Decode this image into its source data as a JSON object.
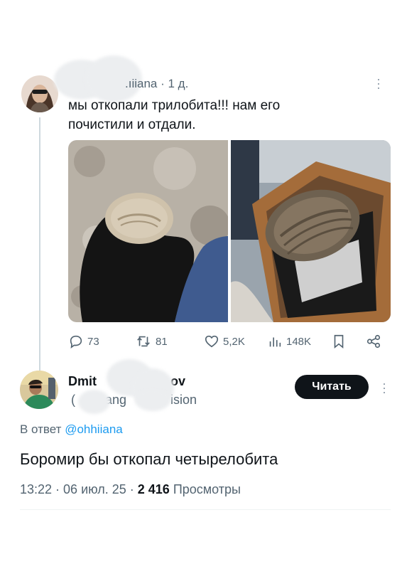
{
  "tweet": {
    "handle_fragment": ".ıiiana",
    "time": "· 1 д.",
    "text_line1": "мы откопали трилобита!!! нам его",
    "text_line2": "почистили и отдали.",
    "stats": {
      "replies": "73",
      "retweets": "81",
      "likes": "5,2K",
      "views": "148K"
    }
  },
  "reply": {
    "name_start": "Dmit",
    "name_end": "ov",
    "handle_start": "(",
    "handle_mid": "ang",
    "handle_end": "ision",
    "follow_label": "Читать",
    "in_reply_to_label": "В ответ",
    "in_reply_to_handle": "@ohhiiana",
    "text": "Боромир бы откопал четырелобита",
    "time": "13:22 · 06 июл. 25 ·",
    "views_count": "2 416",
    "views_label": "Просмотры"
  },
  "colors": {
    "text": "#0f1419",
    "muted": "#536471",
    "link": "#1d9bf0",
    "button_bg": "#0f1419",
    "thread_line": "#cfd9de"
  },
  "icons": [
    "reply-icon",
    "retweet-icon",
    "like-icon",
    "views-icon",
    "bookmark-icon",
    "share-icon",
    "more-icon"
  ]
}
